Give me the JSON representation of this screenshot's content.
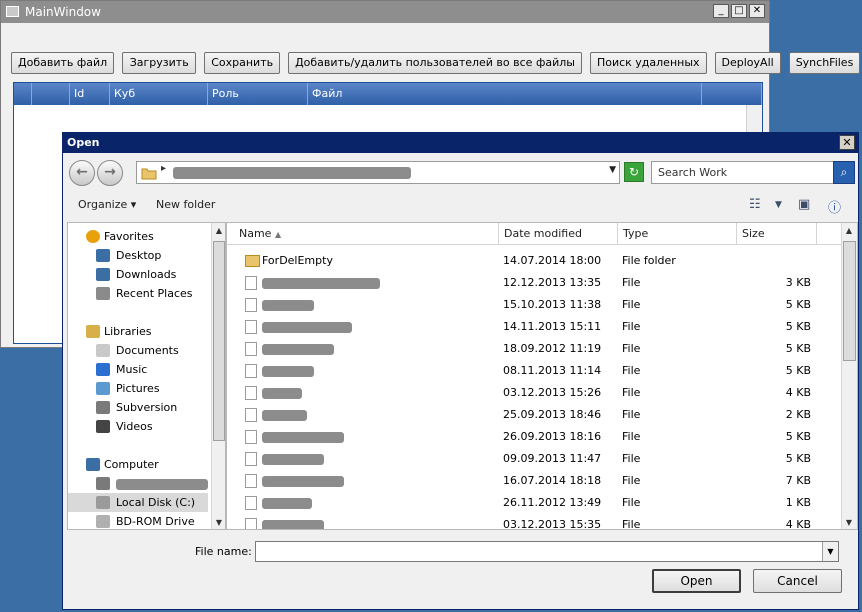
{
  "main_window": {
    "title": "MainWindow",
    "caption": {
      "minimize": "_",
      "maximize": "□",
      "close": "✕"
    },
    "toolbar": [
      {
        "name": "add-file-button",
        "label": "Добавить файл",
        "w": 96
      },
      {
        "name": "load-button",
        "label": "Загрузить",
        "w": 74
      },
      {
        "name": "save-button",
        "label": "Сохранить",
        "w": 74
      },
      {
        "name": "add-remove-users-button",
        "label": "Добавить/удалить пользователей во все файлы",
        "w": 250
      },
      {
        "name": "search-deleted-button",
        "label": "Поиск удаленных",
        "w": 96
      },
      {
        "name": "deploy-all-button",
        "label": "DeployAll",
        "w": 56
      },
      {
        "name": "synch-files-button",
        "label": "SynchFiles",
        "w": 58
      }
    ],
    "grid_columns": [
      "",
      "",
      "Id",
      "Куб",
      "Роль",
      "Файл"
    ]
  },
  "open_dialog": {
    "title": "Open",
    "close_label": "✕",
    "search_placeholder": "Search Work",
    "commands": {
      "organize": "Organize",
      "new_folder": "New folder"
    },
    "nav": [
      {
        "label": "Favorites",
        "icon": "star-icon",
        "group": true
      },
      {
        "label": "Desktop",
        "icon": "desktop-icon"
      },
      {
        "label": "Downloads",
        "icon": "downloads-icon"
      },
      {
        "label": "Recent Places",
        "icon": "recent-places-icon"
      },
      {
        "label": "",
        "icon": ""
      },
      {
        "label": "Libraries",
        "icon": "libraries-icon",
        "group": true
      },
      {
        "label": "Documents",
        "icon": "documents-icon"
      },
      {
        "label": "Music",
        "icon": "music-icon"
      },
      {
        "label": "Pictures",
        "icon": "pictures-icon"
      },
      {
        "label": "Subversion",
        "icon": "subversion-icon"
      },
      {
        "label": "Videos",
        "icon": "videos-icon"
      },
      {
        "label": "",
        "icon": ""
      },
      {
        "label": "Computer",
        "icon": "computer-icon",
        "group": true
      },
      {
        "label": "",
        "icon": "network-drive-icon",
        "blurred": true
      },
      {
        "label": "Local Disk (C:)",
        "icon": "local-disk-icon",
        "selected": true
      },
      {
        "label": "BD-ROM Drive (E:)",
        "icon": "bd-rom-icon"
      }
    ],
    "columns": {
      "name": "Name",
      "date": "Date modified",
      "type": "Type",
      "size": "Size"
    },
    "files": [
      {
        "name": "ForDelEmpty",
        "date": "14.07.2014 18:00",
        "type": "File folder",
        "size": "",
        "folder": true,
        "blur": 0
      },
      {
        "name": "",
        "date": "12.12.2013 13:35",
        "type": "File",
        "size": "3 KB",
        "blur": 118
      },
      {
        "name": "",
        "date": "15.10.2013 11:38",
        "type": "File",
        "size": "5 KB",
        "blur": 52
      },
      {
        "name": "",
        "date": "14.11.2013 15:11",
        "type": "File",
        "size": "5 KB",
        "blur": 90
      },
      {
        "name": "",
        "date": "18.09.2012 11:19",
        "type": "File",
        "size": "5 KB",
        "blur": 72
      },
      {
        "name": "",
        "date": "08.11.2013 11:14",
        "type": "File",
        "size": "5 KB",
        "blur": 52
      },
      {
        "name": "",
        "date": "03.12.2013 15:26",
        "type": "File",
        "size": "4 KB",
        "blur": 40
      },
      {
        "name": "",
        "date": "25.09.2013 18:46",
        "type": "File",
        "size": "2 KB",
        "blur": 45
      },
      {
        "name": "",
        "date": "26.09.2013 18:16",
        "type": "File",
        "size": "5 KB",
        "blur": 82
      },
      {
        "name": "",
        "date": "09.09.2013 11:47",
        "type": "File",
        "size": "5 KB",
        "blur": 62
      },
      {
        "name": "",
        "date": "16.07.2014 18:18",
        "type": "File",
        "size": "7 KB",
        "blur": 82
      },
      {
        "name": "",
        "date": "26.11.2012 13:49",
        "type": "File",
        "size": "1 KB",
        "blur": 50
      },
      {
        "name": "",
        "date": "03.12.2013 15:35",
        "type": "File",
        "size": "4 KB",
        "blur": 62
      }
    ],
    "file_name_label": "File name:",
    "file_name_value": "",
    "open_label": "Open",
    "cancel_label": "Cancel"
  }
}
